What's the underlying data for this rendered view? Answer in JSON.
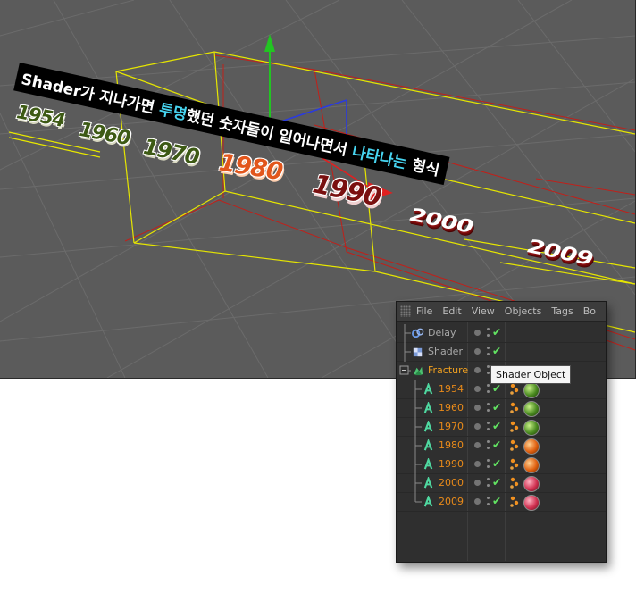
{
  "viewport": {
    "caption_parts": [
      {
        "text": "Shader가 지나가면 ",
        "highlight": false
      },
      {
        "text": "투명",
        "highlight": true
      },
      {
        "text": "했던 숫자들이 일어나면서 ",
        "highlight": false
      },
      {
        "text": "나타나는",
        "highlight": true
      },
      {
        "text": " 형식",
        "highlight": false
      }
    ],
    "years": [
      {
        "text": "1954",
        "style": "green"
      },
      {
        "text": "1960",
        "style": "green"
      },
      {
        "text": "1970",
        "style": "green"
      },
      {
        "text": "1980",
        "style": "orange"
      },
      {
        "text": "1990",
        "style": "maroon"
      },
      {
        "text": "2000",
        "style": "white3d"
      },
      {
        "text": "2009",
        "style": "white3d"
      }
    ],
    "colors": {
      "background": "#5b5b5b",
      "grid": "#6c6c6c",
      "bbox": "#e6e600",
      "shader_box": "#c0201a",
      "axis_y": "#22c422",
      "axis_x": "#e02020",
      "axis_z": "#2a3ae0"
    }
  },
  "object_manager": {
    "menu": [
      "File",
      "Edit",
      "View",
      "Objects",
      "Tags",
      "Bo"
    ],
    "objects": [
      {
        "name": "Delay",
        "icon": "delay-effector-icon",
        "color": "grey",
        "level": 0,
        "tag_dots": false,
        "material": null
      },
      {
        "name": "Shader",
        "icon": "shader-effector-icon",
        "color": "grey",
        "level": 0,
        "tag_dots": false,
        "material": null
      },
      {
        "name": "Fracture",
        "icon": "fracture-object-icon",
        "color": "sel",
        "level": 0,
        "tag_dots": false,
        "material": null,
        "expanded": true
      },
      {
        "name": "1954",
        "icon": "text-spline-icon",
        "color": "orange",
        "level": 1,
        "tag_dots": true,
        "material": "green"
      },
      {
        "name": "1960",
        "icon": "text-spline-icon",
        "color": "orange",
        "level": 1,
        "tag_dots": true,
        "material": "green"
      },
      {
        "name": "1970",
        "icon": "text-spline-icon",
        "color": "orange",
        "level": 1,
        "tag_dots": true,
        "material": "green"
      },
      {
        "name": "1980",
        "icon": "text-spline-icon",
        "color": "orange",
        "level": 1,
        "tag_dots": true,
        "material": "orange"
      },
      {
        "name": "1990",
        "icon": "text-spline-icon",
        "color": "orange",
        "level": 1,
        "tag_dots": true,
        "material": "orange"
      },
      {
        "name": "2000",
        "icon": "text-spline-icon",
        "color": "orange",
        "level": 1,
        "tag_dots": true,
        "material": "pink"
      },
      {
        "name": "2009",
        "icon": "text-spline-icon",
        "color": "orange",
        "level": 1,
        "tag_dots": true,
        "material": "pink"
      }
    ],
    "tooltip": "Shader Object"
  }
}
